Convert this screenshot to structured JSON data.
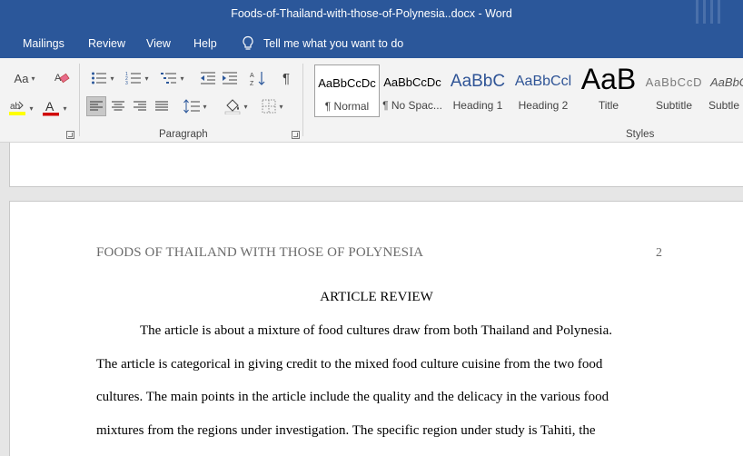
{
  "window": {
    "title": "Foods-of-Thailand-with-those-of-Polynesia..docx  -  Word"
  },
  "menu": {
    "tabs": [
      "Mailings",
      "Review",
      "View",
      "Help"
    ],
    "tell_me": "Tell me what you want to do"
  },
  "ribbon": {
    "font_group": {
      "change_case_label": "Aa"
    },
    "paragraph_group_label": "Paragraph",
    "styles_group_label": "Styles",
    "styles": [
      {
        "preview": "AaBbCcDc",
        "name": "¶ Normal",
        "active": true
      },
      {
        "preview": "AaBbCcDc",
        "name": "¶ No Spac...",
        "active": false
      },
      {
        "preview": "AaBbC",
        "name": "Heading 1",
        "active": false
      },
      {
        "preview": "AaBbCcl",
        "name": "Heading 2",
        "active": false
      },
      {
        "preview": "AaB",
        "name": "Title",
        "active": false
      },
      {
        "preview": "AaBbCcD",
        "name": "Subtitle",
        "active": false
      },
      {
        "preview": "AaBbCcD",
        "name": "Subtle",
        "active": false
      }
    ],
    "colors": {
      "highlight": "#ffff00",
      "font_color": "#d00000",
      "heading_blue": "#2f5496"
    }
  },
  "document": {
    "running_header": "FOODS OF THAILAND WITH THOSE OF POLYNESIA",
    "page_number": "2",
    "heading": "ARTICLE REVIEW",
    "lines": [
      "The article is about a mixture of food cultures draw from both Thailand and Polynesia.",
      "The article is categorical in giving credit to the mixed food culture cuisine from the two food",
      "cultures. The main points in the article include the quality and the delicacy in the various food",
      "mixtures from the regions under investigation. The specific region under study is Tahiti, the"
    ]
  }
}
